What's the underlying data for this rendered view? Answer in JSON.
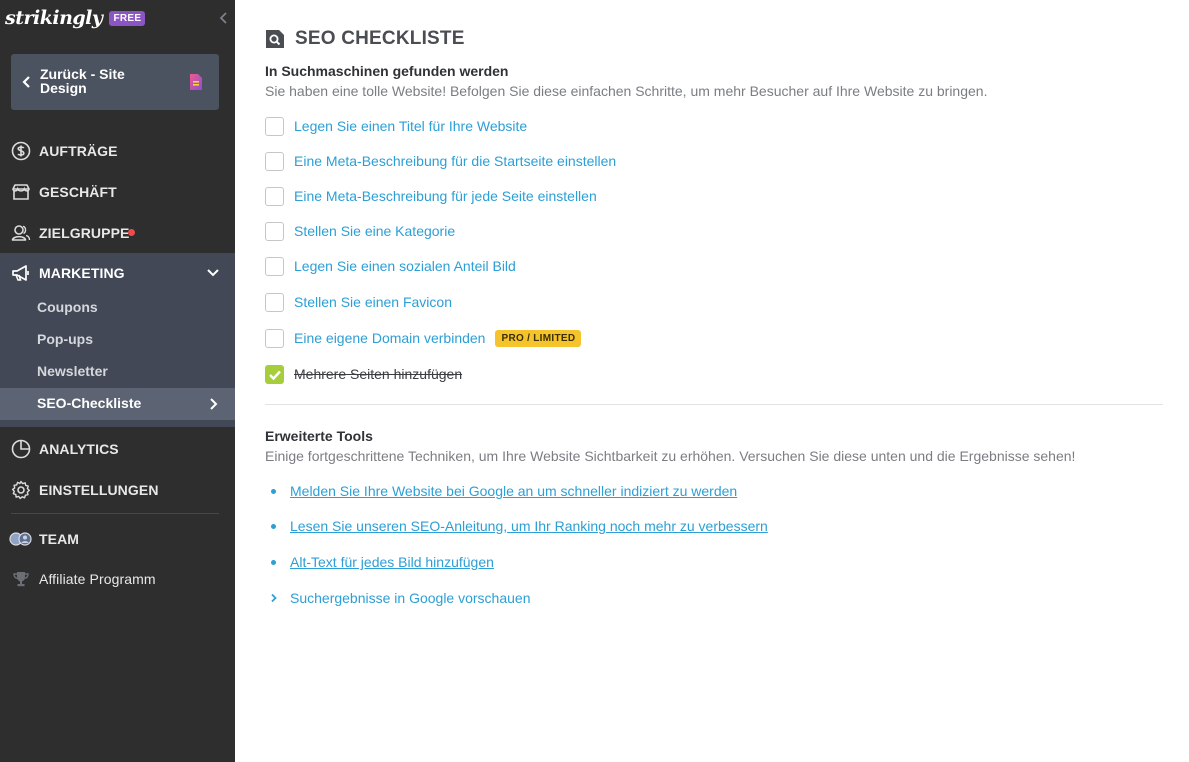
{
  "sidebar": {
    "logo": "strikingly",
    "plan_badge": "FREE",
    "back_label": "Zurück - Site Design",
    "nav": {
      "orders": "AUFTRÄGE",
      "store": "GESCHÄFT",
      "audience": "ZIELGRUPPE",
      "marketing": "MARKETING",
      "analytics": "ANALYTICS",
      "settings": "EINSTELLUNGEN",
      "team": "TEAM",
      "affiliate": "Affiliate Programm"
    },
    "marketing_sub": [
      "Coupons",
      "Pop-ups",
      "Newsletter",
      "SEO-Checkliste"
    ],
    "colors": {
      "background": "#2e2e2f",
      "active": "#424855",
      "current": "#5c6372",
      "notification_dot": "#f24a4a"
    }
  },
  "main": {
    "title": "SEO CHECKLISTE",
    "found": {
      "heading": "In Suchmaschinen gefunden werden",
      "description": "Sie haben eine tolle Website! Befolgen Sie diese einfachen Schritte, um mehr Besucher auf Ihre Website zu bringen.",
      "items": [
        {
          "label": "Legen Sie einen Titel für Ihre Website",
          "checked": false
        },
        {
          "label": "Eine Meta-Beschreibung für die Startseite einstellen",
          "checked": false
        },
        {
          "label": "Eine Meta-Beschreibung für jede Seite einstellen",
          "checked": false
        },
        {
          "label": "Stellen Sie eine Kategorie",
          "checked": false
        },
        {
          "label": "Legen Sie einen sozialen Anteil Bild",
          "checked": false
        },
        {
          "label": "Stellen Sie einen Favicon",
          "checked": false
        },
        {
          "label": "Eine eigene Domain verbinden",
          "checked": false
        },
        {
          "label": "Mehrere Seiten hinzufügen",
          "checked": true
        }
      ],
      "pro_badge": "PRO / LIMITED"
    },
    "advanced": {
      "heading": "Erweiterte Tools",
      "description": "Einige fortgeschrittene Techniken, um Ihre Website Sichtbarkeit zu erhöhen. Versuchen Sie diese unten und die Ergebnisse sehen!",
      "links": [
        "Melden Sie Ihre Website bei Google an um schneller indiziert zu werden",
        "Lesen Sie unseren SEO-Anleitung, um Ihr Ranking noch mehr zu verbessern",
        "Alt-Text für jedes Bild hinzufügen"
      ],
      "preview_toggle": "Suchergebnisse in Google vorschauen"
    },
    "colors": {
      "link": "#2c9fd6",
      "checked": "#a6ce3a",
      "pro_badge": "#f5c32c",
      "free_badge": "#8c55c6"
    }
  }
}
